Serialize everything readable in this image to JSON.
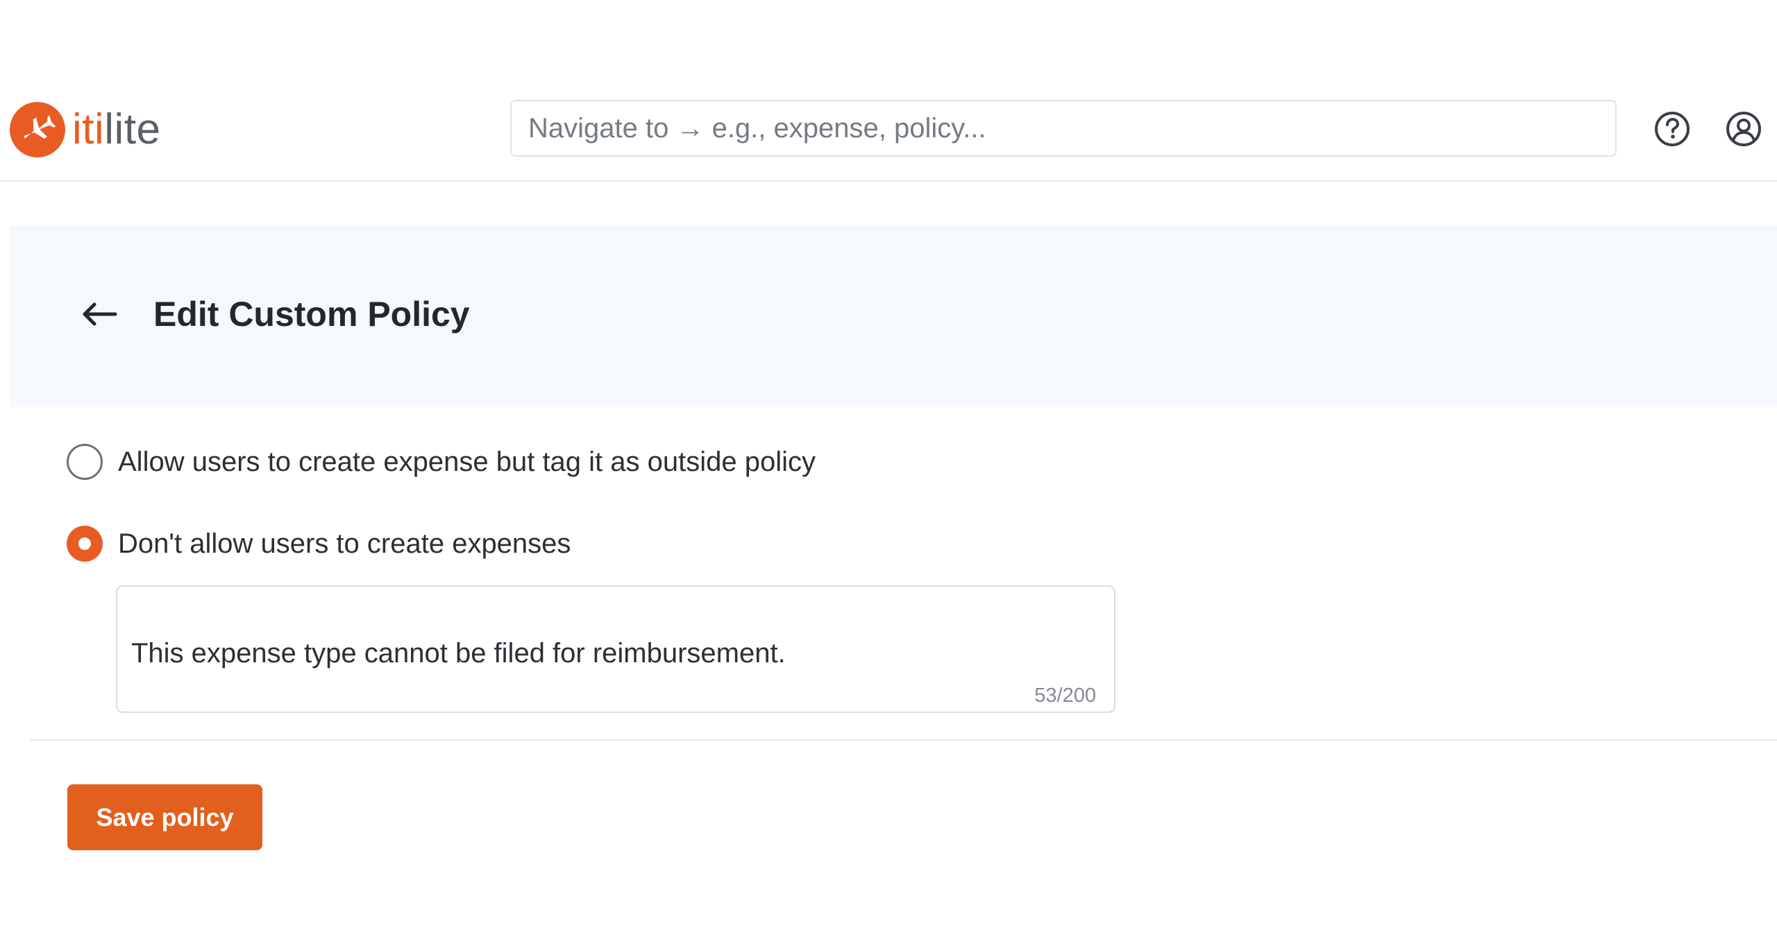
{
  "brand": {
    "name_prefix": "iti",
    "name_suffix": "lite",
    "accent_color": "#e85c23",
    "logo_icon": "airplane-icon"
  },
  "header": {
    "search_placeholder": "Navigate to → e.g., expense, policy...",
    "help_icon": "question-circle-icon",
    "user_icon": "user-circle-icon"
  },
  "page": {
    "back_icon": "arrow-left-icon",
    "title": "Edit Custom Policy"
  },
  "options": [
    {
      "label": "Allow users to create expense but tag it as outside policy",
      "selected": false
    },
    {
      "label": "Don't allow users to create expenses",
      "selected": true
    }
  ],
  "message": {
    "value": "This expense type cannot be filed for reimbursement.",
    "char_count": "53/200"
  },
  "actions": {
    "save_label": "Save policy",
    "save_color": "#e2601d"
  }
}
